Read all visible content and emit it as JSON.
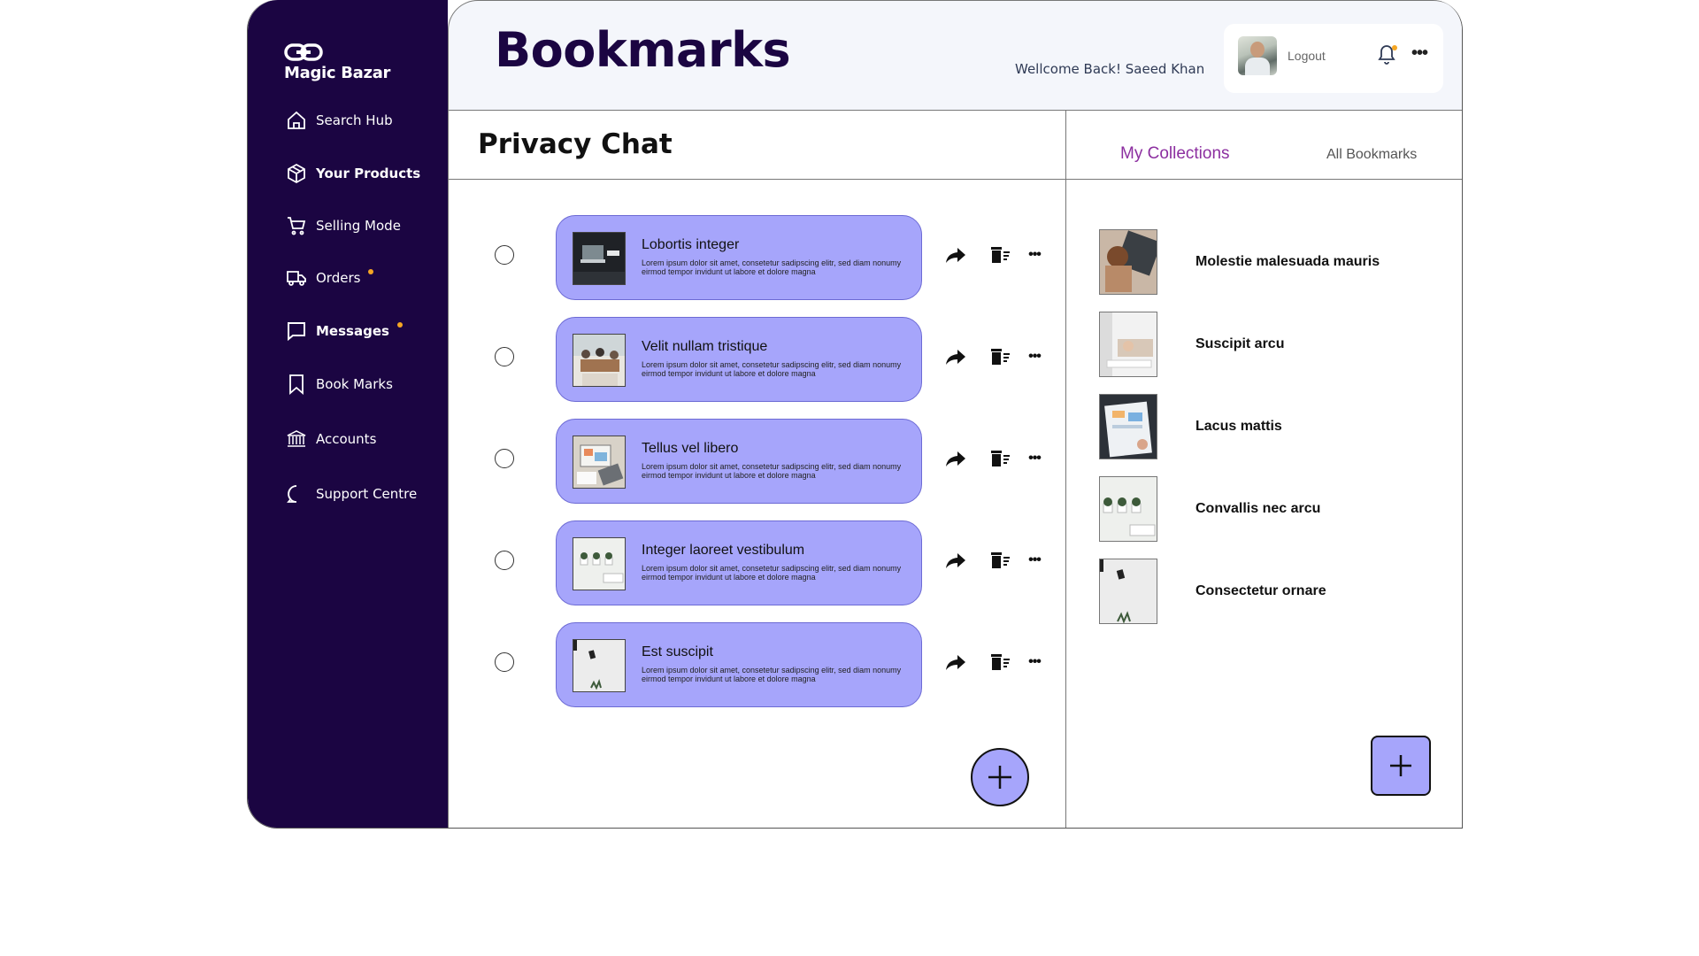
{
  "brand": {
    "name": "Magic Bazar"
  },
  "sidebar": {
    "items": [
      {
        "label": "Search Hub",
        "icon": "home-icon"
      },
      {
        "label": "Your Products",
        "icon": "box-icon"
      },
      {
        "label": "Selling Mode",
        "icon": "cart-icon"
      },
      {
        "label": "Orders",
        "icon": "truck-icon",
        "badge": true
      },
      {
        "label": "Messages",
        "icon": "message-icon",
        "badge": true
      },
      {
        "label": "Book Marks",
        "icon": "bookmark-icon"
      },
      {
        "label": "Accounts",
        "icon": "bank-icon"
      },
      {
        "label": "Support Centre",
        "icon": "chat-bubble-icon"
      }
    ]
  },
  "header": {
    "title": "Bookmarks",
    "welcome": "Wellcome Back!  Saeed Khan",
    "logout": "Logout"
  },
  "left_panel": {
    "title": "Privacy Chat",
    "items": [
      {
        "title": "Lobortis integer",
        "desc": "Lorem ipsum dolor sit amet, consetetur sadipscing elitr, sed diam nonumy eirmod tempor invidunt ut labore et dolore magna"
      },
      {
        "title": "Velit nullam tristique",
        "desc": "Lorem ipsum dolor sit amet, consetetur sadipscing elitr, sed diam nonumy eirmod tempor invidunt ut labore et dolore magna"
      },
      {
        "title": "Tellus vel libero",
        "desc": "Lorem ipsum dolor sit amet, consetetur sadipscing elitr, sed diam nonumy eirmod tempor invidunt ut labore et dolore magna"
      },
      {
        "title": "Integer laoreet vestibulum",
        "desc": "Lorem ipsum dolor sit amet, consetetur sadipscing elitr, sed diam nonumy eirmod tempor invidunt ut labore et dolore magna"
      },
      {
        "title": "Est suscipit",
        "desc": "Lorem ipsum dolor sit amet, consetetur sadipscing elitr, sed diam nonumy eirmod tempor invidunt ut labore et dolore magna"
      }
    ]
  },
  "right_panel": {
    "tabs": [
      {
        "label": "My Collections",
        "active": true
      },
      {
        "label": "All Bookmarks",
        "active": false
      }
    ],
    "collections": [
      {
        "label": "Molestie malesuada mauris"
      },
      {
        "label": "Suscipit arcu"
      },
      {
        "label": "Lacus mattis"
      },
      {
        "label": "Convallis nec arcu"
      },
      {
        "label": "Consectetur ornare"
      }
    ]
  },
  "colors": {
    "sidebar_bg": "#1b0542",
    "card_bg": "#a6a5fb",
    "accent_tab": "#8c2fa0",
    "badge": "#f5a623"
  }
}
